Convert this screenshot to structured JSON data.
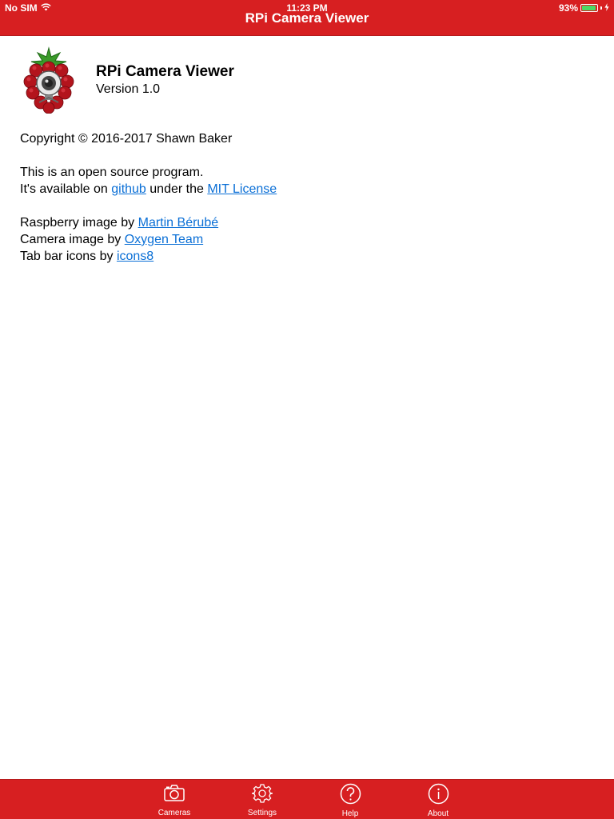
{
  "status_bar": {
    "carrier": "No SIM",
    "time": "11:23 PM",
    "battery_percent": "93%",
    "battery_level": 0.93,
    "wifi_icon": "wifi-icon",
    "battery_icon": "battery-icon",
    "charging_icon": "charging-bolt-icon"
  },
  "nav": {
    "title": "RPi Camera Viewer"
  },
  "about": {
    "app_icon": "raspberry-camera-logo",
    "app_name": "RPi Camera Viewer",
    "version": "Version 1.0",
    "copyright": "Copyright © 2016-2017 Shawn Baker",
    "open_source_line": "This is an open source program.",
    "available_prefix": "It's available on ",
    "github_link": "github",
    "available_middle": " under the ",
    "license_link": "MIT License",
    "raspberry_credit_prefix": "Raspberry image by ",
    "raspberry_credit_link": "Martin Bérubé",
    "camera_credit_prefix": "Camera image by ",
    "camera_credit_link": "Oxygen Team",
    "icons_credit_prefix": "Tab bar icons by ",
    "icons_credit_link": "icons8"
  },
  "tabbar": {
    "tabs": [
      {
        "label": "Cameras",
        "icon": "camera-icon"
      },
      {
        "label": "Settings",
        "icon": "gear-icon"
      },
      {
        "label": "Help",
        "icon": "help-icon"
      },
      {
        "label": "About",
        "icon": "info-icon"
      }
    ]
  },
  "colors": {
    "accent": "#d71f21",
    "link": "#0a6fd6",
    "battery": "#4cd964"
  }
}
